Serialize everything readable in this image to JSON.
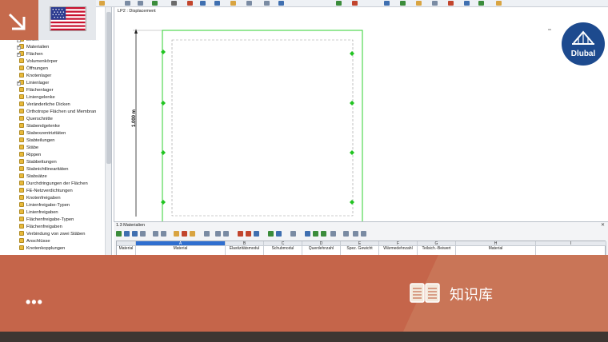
{
  "viewport": {
    "label": "LP2 : Displacement",
    "dimension": "1.000 m"
  },
  "navigator": {
    "items": [
      {
        "label": "Linien",
        "expander": "+"
      },
      {
        "label": "Materialien",
        "expander": "+"
      },
      {
        "label": "Flächen",
        "expander": "+"
      },
      {
        "label": "Volumenkörper",
        "expander": ""
      },
      {
        "label": "Öffnungen",
        "expander": ""
      },
      {
        "label": "Knotenlager",
        "expander": ""
      },
      {
        "label": "Linienlager",
        "expander": "+"
      },
      {
        "label": "Flächenlager",
        "expander": ""
      },
      {
        "label": "Liniengelenke",
        "expander": ""
      },
      {
        "label": "Veränderliche Dicken",
        "expander": ""
      },
      {
        "label": "Orthotrope Flächen und Membran",
        "expander": ""
      },
      {
        "label": "Querschnitte",
        "expander": ""
      },
      {
        "label": "Stabendgelenke",
        "expander": ""
      },
      {
        "label": "Stabexzentrizitäten",
        "expander": ""
      },
      {
        "label": "Stabteilungen",
        "expander": ""
      },
      {
        "label": "Stäbe",
        "expander": ""
      },
      {
        "label": "Rippen",
        "expander": ""
      },
      {
        "label": "Stabbettungen",
        "expander": ""
      },
      {
        "label": "Stabnichtlinearitäten",
        "expander": ""
      },
      {
        "label": "Stabsätze",
        "expander": ""
      },
      {
        "label": "Durchdringungen der Flächen",
        "expander": ""
      },
      {
        "label": "FE-Netzverdichtungen",
        "expander": ""
      },
      {
        "label": "Knotenfreigaben",
        "expander": ""
      },
      {
        "label": "Linienfreigabe-Typen",
        "expander": ""
      },
      {
        "label": "Linienfreigaben",
        "expander": ""
      },
      {
        "label": "Flächenfreigabe-Typen",
        "expander": ""
      },
      {
        "label": "Flächenfreigaben",
        "expander": ""
      },
      {
        "label": "Verbindung von zwei Stäben",
        "expander": ""
      },
      {
        "label": "Anschlüsse",
        "expander": ""
      },
      {
        "label": "Knotenkopplungen",
        "expander": ""
      }
    ]
  },
  "table": {
    "title": "1.3 Materialien",
    "close": "✕",
    "row_header": "Material",
    "columns": [
      {
        "letter": "A",
        "caption": "Material"
      },
      {
        "letter": "B",
        "caption": "Elastizitätsmodul"
      },
      {
        "letter": "C",
        "caption": "Schubmodul"
      },
      {
        "letter": "D",
        "caption": "Querdehnzahl"
      },
      {
        "letter": "E",
        "caption": "Spez. Gewicht"
      },
      {
        "letter": "F",
        "caption": "Wärmedehnzahl"
      },
      {
        "letter": "G",
        "caption": "Teilsich.-Beiwert"
      },
      {
        "letter": "H",
        "caption": "Material"
      },
      {
        "letter": "I",
        "caption": ""
      }
    ]
  },
  "logo": {
    "text": "Dlubal",
    "color": "#1d4a8e"
  },
  "banner": {
    "more": "•••",
    "label": "知识库",
    "color": "#c56a4c"
  },
  "corner": {
    "color": "#c56a4c"
  }
}
